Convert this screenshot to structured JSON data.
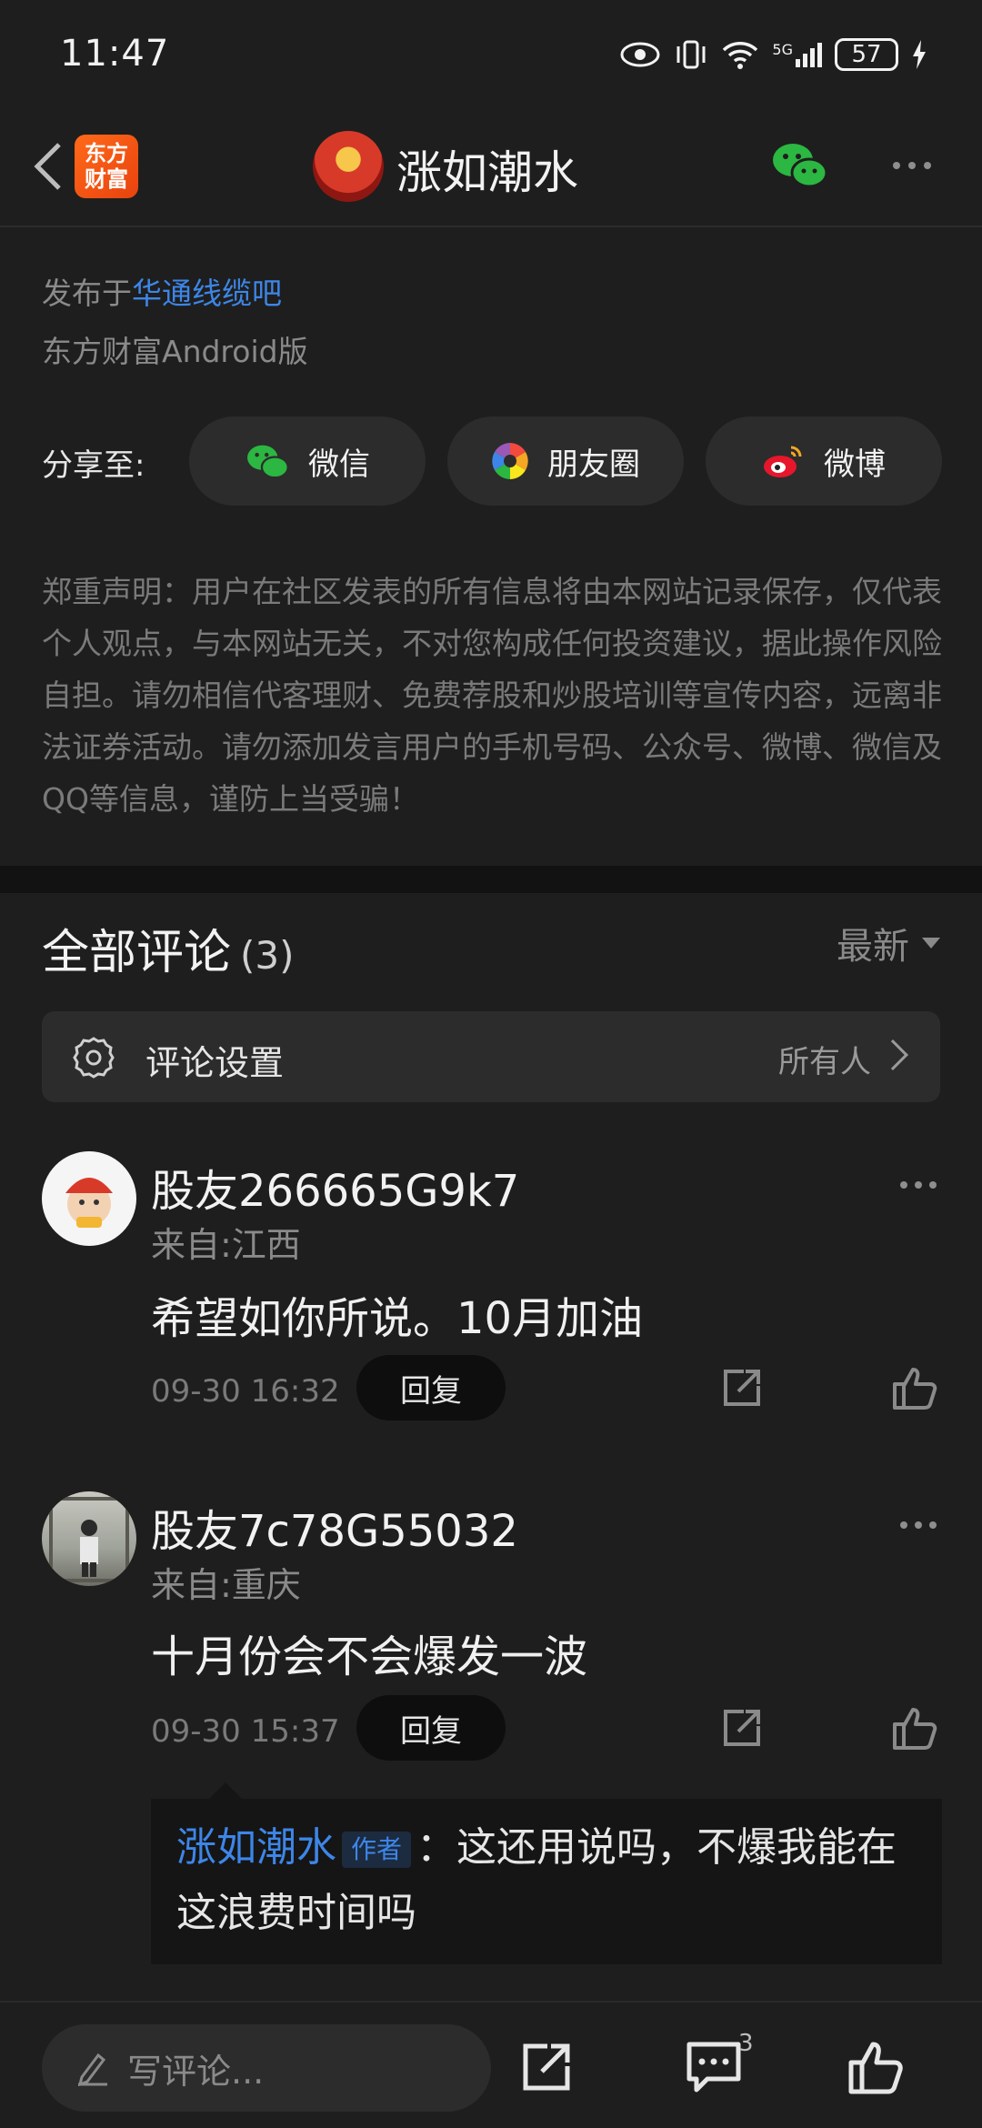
{
  "status_bar": {
    "time": "11:47",
    "battery": "57",
    "network": "5G"
  },
  "nav": {
    "logo_line1": "东方",
    "logo_line2": "财富",
    "author_name": "涨如潮水"
  },
  "post_meta": {
    "published_prefix": "发布于",
    "bar_name": "华通线缆吧",
    "client": "东方财富Android版"
  },
  "share": {
    "label": "分享至:",
    "options": [
      {
        "label": "微信",
        "icon": "wechat-icon"
      },
      {
        "label": "朋友圈",
        "icon": "moments-icon"
      },
      {
        "label": "微博",
        "icon": "weibo-icon"
      }
    ]
  },
  "disclaimer": "郑重声明：用户在社区发表的所有信息将由本网站记录保存，仅代表个人观点，与本网站无关，不对您构成任何投资建议，据此操作风险自担。请勿相信代客理财、免费荐股和炒股培训等宣传内容，远离非法证券活动。请勿添加发言用户的手机号码、公众号、微博、微信及QQ等信息，谨防上当受骗！",
  "comments_section": {
    "title": "全部评论",
    "count": "(3)",
    "sort": "最新",
    "settings_label": "评论设置",
    "settings_value": "所有人"
  },
  "comments": [
    {
      "user": "股友266665G9k7",
      "location": "来自:江西",
      "text": "希望如你所说。10月加油",
      "time": "09-30 16:32",
      "reply_label": "回复"
    },
    {
      "user": "股友7c78G55032",
      "location": "来自:重庆",
      "text": "十月份会不会爆发一波",
      "time": "09-30 15:37",
      "reply_label": "回复"
    }
  ],
  "reply": {
    "author": "涨如潮水",
    "tag": "作者",
    "text": "：这还用说吗，不爆我能在这浪费时间吗"
  },
  "bottom_bar": {
    "input_placeholder": "写评论...",
    "comment_count": "3"
  },
  "colors": {
    "accent_blue": "#3d86e8",
    "background": "#1e1e1e",
    "wechat_green": "#2bb741"
  }
}
